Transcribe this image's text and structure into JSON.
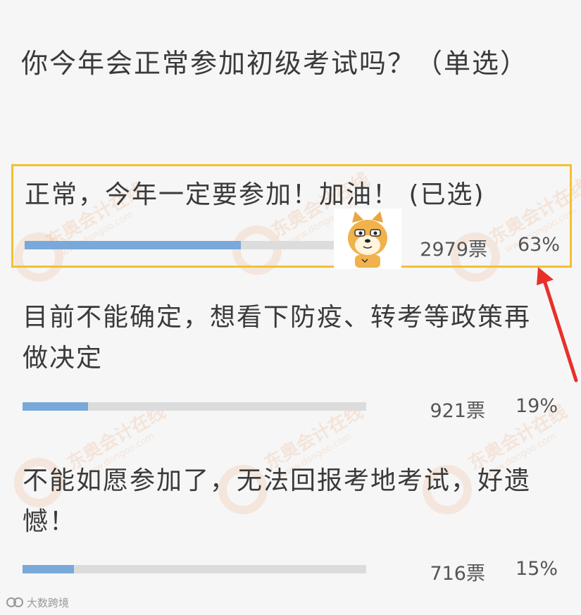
{
  "poll": {
    "question": "你今年会正常参加初级考试吗？（单选）",
    "options": [
      {
        "label": "正常，今年一定要参加！加油！ (已选)",
        "votes": "2979票",
        "percent": "63%",
        "share": 0.63,
        "selected": true
      },
      {
        "label": "目前不能确定，想看下防疫、转考等政策再做决定",
        "votes": "921票",
        "percent": "19%",
        "share": 0.19,
        "selected": false
      },
      {
        "label": "不能如愿参加了，无法回报考地考试，好遗憾！",
        "votes": "716票",
        "percent": "15%",
        "share": 0.15,
        "selected": false
      }
    ]
  },
  "watermark": {
    "brand": "东奥会计在线",
    "url": "www.dongoo.com"
  },
  "footer": {
    "logo_text": "大数跨境"
  },
  "colors": {
    "selected_border": "#f3c030",
    "bar_fill": "#79a9da",
    "bar_track": "#dcdcdc",
    "arrow": "#e8302a"
  },
  "icons": {
    "sticker": "shiba-dog-sticker",
    "arrow": "red-arrow-annotation"
  }
}
